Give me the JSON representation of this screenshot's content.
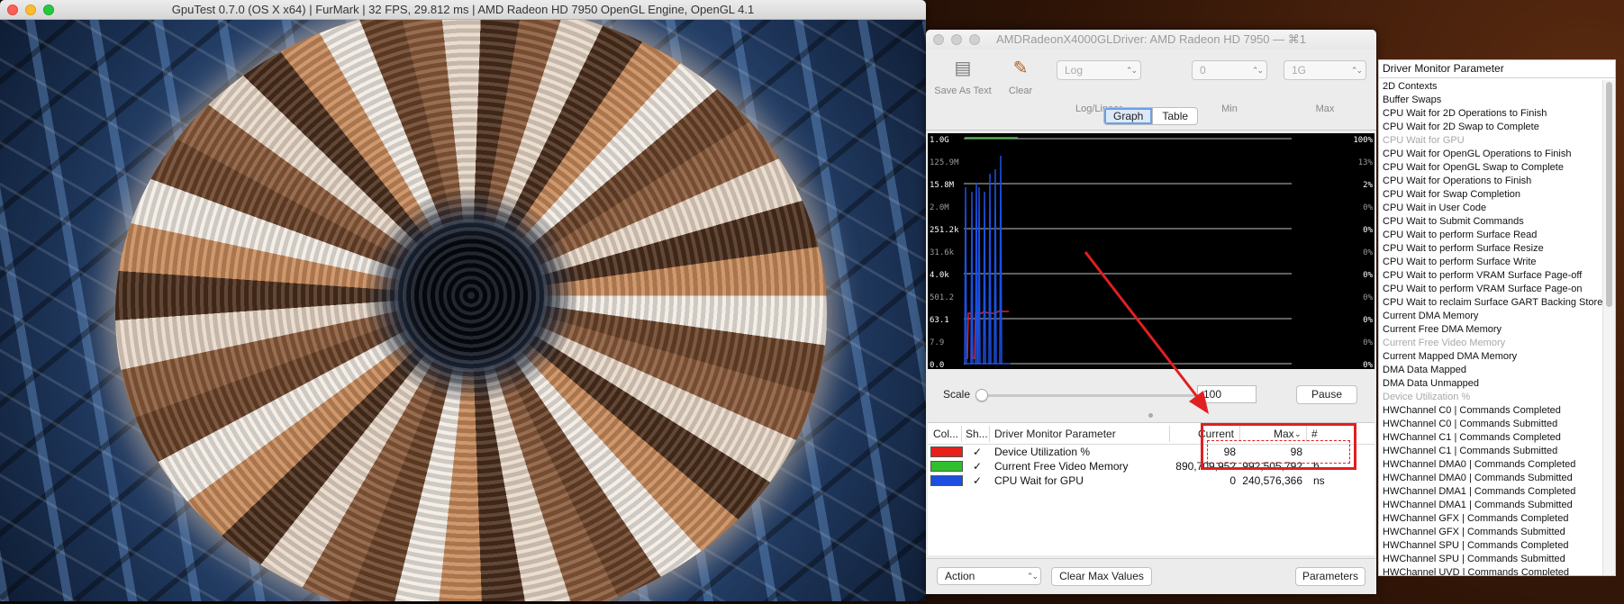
{
  "gpu_window": {
    "title": "GpuTest 0.7.0 (OS X x64) | FurMark | 32 FPS, 29.812 ms | AMD Radeon HD 7950 OpenGL Engine, OpenGL 4.1"
  },
  "monitor_window": {
    "title": "AMDRadeonX4000GLDriver: AMD Radeon HD 7950 — ⌘1",
    "toolbar": {
      "save_label": "Save As Text",
      "clear_label": "Clear",
      "scale_mode_value": "Log",
      "scale_mode_caption": "Log/Linear",
      "min_value": "0",
      "min_caption": "Min",
      "max_value": "1G",
      "max_caption": "Max"
    },
    "view_tabs": [
      {
        "label": "Graph",
        "active": true
      },
      {
        "label": "Table",
        "active": false
      }
    ],
    "graph": {
      "left_axis": [
        "1.0G",
        "125.9M",
        "15.8M",
        "2.0M",
        "251.2k",
        "31.6k",
        "4.0k",
        "501.2",
        "63.1",
        "7.9",
        "0.0"
      ],
      "right_axis": [
        "100%",
        "13%",
        "2%",
        "0%",
        "0%",
        "0%",
        "0%",
        "0%",
        "0%",
        "0%",
        "0%"
      ]
    },
    "scale": {
      "label": "Scale",
      "value": "100",
      "pause_label": "Pause"
    },
    "table": {
      "headers": [
        "Col...",
        "Sh...",
        "Driver Monitor Parameter",
        "Current",
        "Max",
        "#"
      ],
      "rows": [
        {
          "color": "#e8201c",
          "shown": "✓",
          "parameter": "Device Utilization %",
          "current": "98",
          "max": "98",
          "unit": ""
        },
        {
          "color": "#2fc02c",
          "shown": "✓",
          "parameter": "Current Free Video Memory",
          "current": "890,709,952",
          "max": "992,505,792",
          "unit": "b"
        },
        {
          "color": "#1c4fe0",
          "shown": "✓",
          "parameter": "CPU Wait for GPU",
          "current": "0",
          "max": "240,576,366",
          "unit": "ns"
        }
      ]
    },
    "bottom": {
      "action_label": "Action",
      "clear_max_label": "Clear Max Values",
      "parameters_label": "Parameters"
    }
  },
  "param_panel": {
    "header": "Driver Monitor Parameter",
    "items": [
      {
        "label": "2D Contexts",
        "dim": false
      },
      {
        "label": "Buffer Swaps",
        "dim": false
      },
      {
        "label": "CPU Wait for 2D Operations to Finish",
        "dim": false
      },
      {
        "label": "CPU Wait for 2D Swap to Complete",
        "dim": false
      },
      {
        "label": "CPU Wait for GPU",
        "dim": true
      },
      {
        "label": "CPU Wait for OpenGL Operations to Finish",
        "dim": false
      },
      {
        "label": "CPU Wait for OpenGL Swap to Complete",
        "dim": false
      },
      {
        "label": "CPU Wait for Operations to Finish",
        "dim": false
      },
      {
        "label": "CPU Wait for Swap Completion",
        "dim": false
      },
      {
        "label": "CPU Wait in User Code",
        "dim": false
      },
      {
        "label": "CPU Wait to Submit Commands",
        "dim": false
      },
      {
        "label": "CPU Wait to perform Surface Read",
        "dim": false
      },
      {
        "label": "CPU Wait to perform Surface Resize",
        "dim": false
      },
      {
        "label": "CPU Wait to perform Surface Write",
        "dim": false
      },
      {
        "label": "CPU Wait to perform VRAM Surface Page-off",
        "dim": false
      },
      {
        "label": "CPU Wait to perform VRAM Surface Page-on",
        "dim": false
      },
      {
        "label": "CPU Wait to reclaim Surface GART Backing Store",
        "dim": false
      },
      {
        "label": "Current DMA Memory",
        "dim": false
      },
      {
        "label": "Current Free DMA Memory",
        "dim": false
      },
      {
        "label": "Current Free Video Memory",
        "dim": true
      },
      {
        "label": "Current Mapped DMA Memory",
        "dim": false
      },
      {
        "label": "DMA Data Mapped",
        "dim": false
      },
      {
        "label": "DMA Data Unmapped",
        "dim": false
      },
      {
        "label": "Device Utilization %",
        "dim": true
      },
      {
        "label": "HWChannel C0 | Commands Completed",
        "dim": false
      },
      {
        "label": "HWChannel C0 | Commands Submitted",
        "dim": false
      },
      {
        "label": "HWChannel C1 | Commands Completed",
        "dim": false
      },
      {
        "label": "HWChannel C1 | Commands Submitted",
        "dim": false
      },
      {
        "label": "HWChannel DMA0 | Commands Completed",
        "dim": false
      },
      {
        "label": "HWChannel DMA0 | Commands Submitted",
        "dim": false
      },
      {
        "label": "HWChannel DMA1 | Commands Completed",
        "dim": false
      },
      {
        "label": "HWChannel DMA1 | Commands Submitted",
        "dim": false
      },
      {
        "label": "HWChannel GFX | Commands Completed",
        "dim": false
      },
      {
        "label": "HWChannel GFX | Commands Submitted",
        "dim": false
      },
      {
        "label": "HWChannel SPU | Commands Completed",
        "dim": false
      },
      {
        "label": "HWChannel SPU | Commands Submitted",
        "dim": false
      },
      {
        "label": "HWChannel UVD | Commands Completed",
        "dim": false
      }
    ]
  },
  "colors": {
    "accent_blue": "#6aa0e6",
    "annotation_red": "#e02020"
  }
}
